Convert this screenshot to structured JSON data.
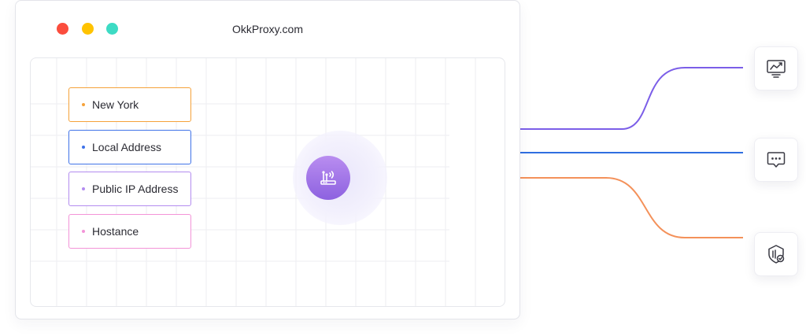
{
  "window": {
    "title": "OkkProxy.com",
    "traffic_lights": {
      "red": "#fb4d3d",
      "yellow": "#ffc300",
      "green": "#3ddbc4"
    }
  },
  "locations": [
    {
      "label": "New York",
      "color": "#f5a23a"
    },
    {
      "label": "Local Address",
      "color": "#3f72e8"
    },
    {
      "label": "Public IP Address",
      "color": "#b38cf0"
    },
    {
      "label": "Hostance",
      "color": "#f394d8"
    }
  ],
  "router": {
    "icon": "router-wifi-icon",
    "color": "#9b6ee6"
  },
  "connections": [
    {
      "color": "#7b5ee8"
    },
    {
      "color": "#2f6ee0"
    },
    {
      "color": "#f4915a"
    }
  ],
  "apps": [
    {
      "icon": "chart-monitor-icon"
    },
    {
      "icon": "chat-bubble-icon"
    },
    {
      "icon": "shield-check-icon"
    }
  ]
}
